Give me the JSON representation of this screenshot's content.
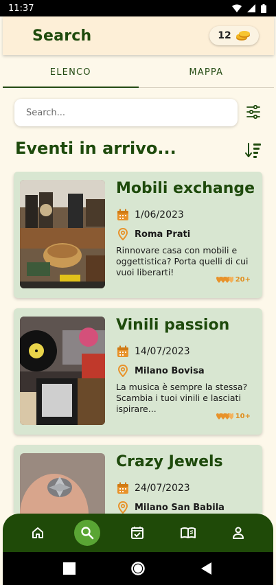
{
  "status": {
    "time": "11:37"
  },
  "header": {
    "title": "Search",
    "coins": "12"
  },
  "tabs": [
    {
      "label": "ELENCO"
    },
    {
      "label": "MAPPA"
    }
  ],
  "search": {
    "placeholder": "Search..."
  },
  "section": {
    "title": "Eventi in arrivo..."
  },
  "events": [
    {
      "title": "Mobili exchange",
      "date": "1/06/2023",
      "place": "Roma Prati",
      "description": "Rinnovare casa con mobili e oggettistica? Porta quelli di cui vuoi liberarti!",
      "rating": "20+"
    },
    {
      "title": "Vinili passion",
      "date": "14/07/2023",
      "place": "Milano Bovisa",
      "description": "La musica è sempre la stessa? Scambia i tuoi vinili e lasciati ispirare...",
      "rating": "10+"
    },
    {
      "title": "Crazy Jewels",
      "date": "24/07/2023",
      "place": "Milano San Babila",
      "description": "",
      "rating": ""
    }
  ],
  "nav": [
    {
      "icon": "home-icon"
    },
    {
      "icon": "search-icon"
    },
    {
      "icon": "calendar-check-icon"
    },
    {
      "icon": "book-icon"
    },
    {
      "icon": "person-icon"
    }
  ],
  "colors": {
    "primary_green": "#1e4a0c",
    "nav_green": "#1f4a08",
    "active_green": "#59a534",
    "card_bg": "#d8e6d1",
    "header_bg": "#fdefd7",
    "accent_orange": "#e8922a"
  }
}
